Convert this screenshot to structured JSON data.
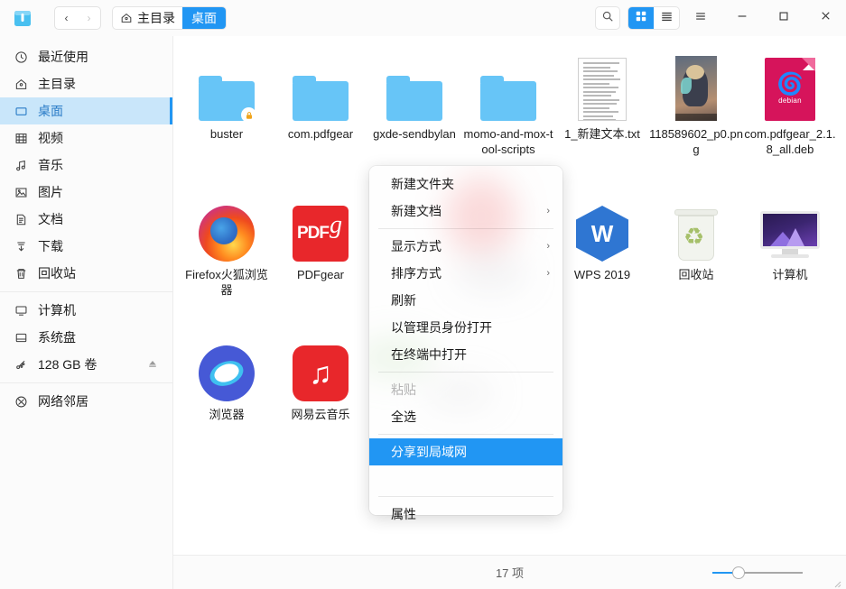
{
  "window": {
    "app_icon": "file-manager-icon",
    "controls": {
      "minimize": "—",
      "maximize": "□",
      "close": "✕",
      "menu": "☰"
    }
  },
  "nav": {
    "back": "‹",
    "forward": "›"
  },
  "breadcrumb": {
    "home_label": "主目录",
    "current_label": "桌面"
  },
  "toolbar": {
    "search_icon": "search-icon",
    "icon_view_icon": "grid-view-icon",
    "list_view_icon": "list-view-icon",
    "menu_icon": "hamburger-menu-icon",
    "selected_view": "icon"
  },
  "sidebar": {
    "groups": [
      {
        "items": [
          {
            "label": "最近使用",
            "icon": "clock-icon",
            "selected": false
          },
          {
            "label": "主目录",
            "icon": "home-icon",
            "selected": false
          },
          {
            "label": "桌面",
            "icon": "desktop-icon",
            "selected": true
          },
          {
            "label": "视频",
            "icon": "video-icon",
            "selected": false
          },
          {
            "label": "音乐",
            "icon": "music-icon",
            "selected": false
          },
          {
            "label": "图片",
            "icon": "pictures-icon",
            "selected": false
          },
          {
            "label": "文档",
            "icon": "documents-icon",
            "selected": false
          },
          {
            "label": "下载",
            "icon": "downloads-icon",
            "selected": false
          },
          {
            "label": "回收站",
            "icon": "trash-icon",
            "selected": false
          }
        ]
      },
      {
        "items": [
          {
            "label": "计算机",
            "icon": "computer-icon",
            "selected": false
          },
          {
            "label": "系统盘",
            "icon": "disk-icon",
            "selected": false
          },
          {
            "label": "128 GB 卷",
            "icon": "usb-icon",
            "selected": false,
            "eject": true
          }
        ]
      },
      {
        "items": [
          {
            "label": "网络邻居",
            "icon": "network-icon",
            "selected": false
          }
        ]
      }
    ]
  },
  "files": [
    {
      "name": "buster",
      "type": "folder",
      "badge": "lock"
    },
    {
      "name": "com.pdfgear",
      "type": "folder"
    },
    {
      "name": "gxde-sendbylan",
      "type": "folder"
    },
    {
      "name": "momo-and-mox-tool-scripts",
      "type": "folder"
    },
    {
      "name": "1_新建文本.txt",
      "type": "text"
    },
    {
      "name": "118589602_p0.png",
      "type": "image"
    },
    {
      "name": "com.pdfgear_2.1.8_all.deb",
      "type": "deb",
      "deb_label": "debian"
    },
    {
      "name": "Firefox火狐浏览器",
      "type": "firefox"
    },
    {
      "name": "PDFgear",
      "type": "pdfgear",
      "pdf_text": "PDF",
      "pdf_mark": "g"
    },
    {
      "name": "WPS 2019",
      "type": "wps",
      "wps_mark": "W"
    },
    {
      "name": "回收站",
      "type": "trash"
    },
    {
      "name": "计算机",
      "type": "computer"
    },
    {
      "name": "浏览器",
      "type": "browser"
    },
    {
      "name": "网易云音乐",
      "type": "netease"
    }
  ],
  "context_menu": {
    "items": [
      {
        "label": "新建文件夹",
        "submenu": false,
        "disabled": false,
        "selected": false
      },
      {
        "label": "新建文档",
        "submenu": true,
        "disabled": false,
        "selected": false
      },
      {
        "separator": true
      },
      {
        "label": "显示方式",
        "submenu": true,
        "disabled": false,
        "selected": false
      },
      {
        "label": "排序方式",
        "submenu": true,
        "disabled": false,
        "selected": false
      },
      {
        "label": "刷新",
        "submenu": false,
        "disabled": false,
        "selected": false
      },
      {
        "label": "以管理员身份打开",
        "submenu": false,
        "disabled": false,
        "selected": false
      },
      {
        "label": "在终端中打开",
        "submenu": false,
        "disabled": false,
        "selected": false
      },
      {
        "separator": true
      },
      {
        "label": "粘贴",
        "submenu": false,
        "disabled": true,
        "selected": false
      },
      {
        "label": "全选",
        "submenu": false,
        "disabled": false,
        "selected": false
      },
      {
        "separator": true
      },
      {
        "label": "分享到局域网",
        "submenu": false,
        "disabled": false,
        "selected": true
      },
      {
        "label": "",
        "submenu": false,
        "disabled": false,
        "selected": false
      },
      {
        "separator": true
      },
      {
        "label": "属性",
        "submenu": false,
        "disabled": false,
        "selected": false
      }
    ],
    "submenu_arrow": "›"
  },
  "statusbar": {
    "item_count": "17 项",
    "zoom_percent": 25
  },
  "colors": {
    "accent": "#2196f3",
    "sidebar_selected_bg": "#c9e6fa",
    "sidebar_selected_text": "#2b7cc7",
    "folder": "#67c5f7",
    "menu_highlight": "#2196f3",
    "red_icon": "#e8272b",
    "deb": "#d6145b"
  }
}
